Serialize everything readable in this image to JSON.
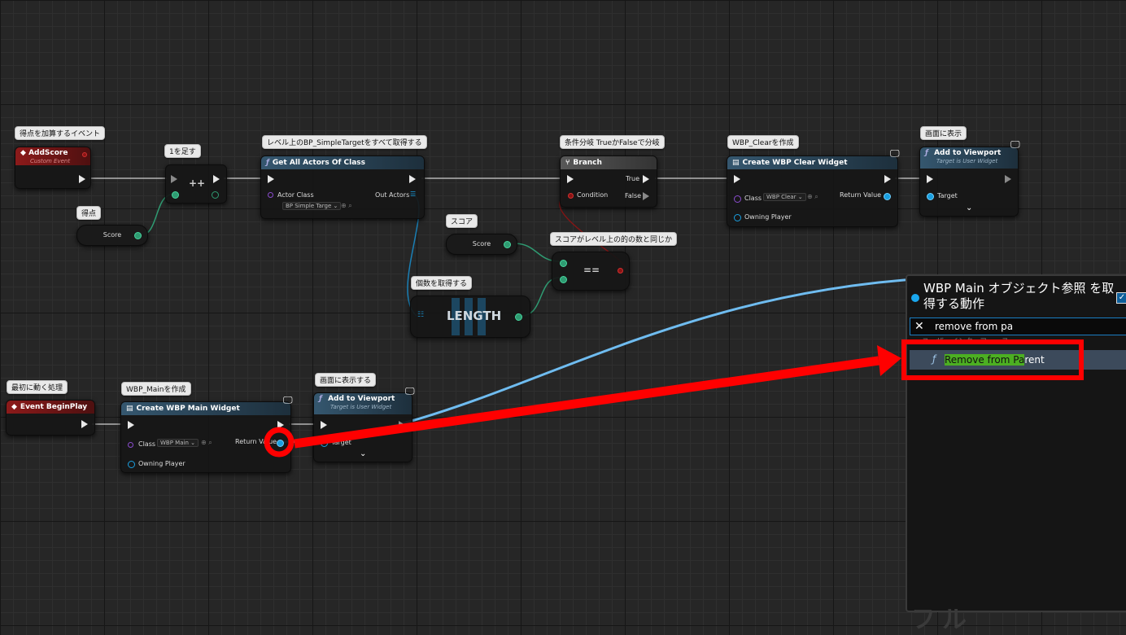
{
  "comments": {
    "add_score_event": "得点を加算するイベント",
    "add_one": "1を足す",
    "get_all_actors": "レベル上のBP_SimpleTargetをすべて取得する",
    "branch_comment": "条件分岐 TrueかFalseで分岐",
    "create_clear": "WBP_Clearを作成",
    "show_clear": "画面に表示",
    "score_var": "得点",
    "score_var2": "スコア",
    "equal_comment": "スコアがレベル上の的の数と同じか",
    "length_comment": "個数を取得する",
    "begin_comment": "最初に動く処理",
    "create_main": "WBP_Mainを作成",
    "show_main": "画面に表示する"
  },
  "nodes": {
    "add_score": {
      "title": "AddScore",
      "subtitle": "Custom Event"
    },
    "increment": {
      "title": "++"
    },
    "get_all_actors": {
      "title": "Get All Actors Of Class",
      "actor_class_label": "Actor Class",
      "actor_class_value": "BP Simple Targe",
      "out_actors_label": "Out Actors"
    },
    "branch": {
      "title": "Branch",
      "true_label": "True",
      "false_label": "False",
      "condition_label": "Condition"
    },
    "create_clear": {
      "title": "Create WBP Clear Widget",
      "class_label": "Class",
      "class_value": "WBP Clear",
      "return_label": "Return Value",
      "owning_label": "Owning Player"
    },
    "add_viewport_top": {
      "title": "Add to Viewport",
      "subtitle": "Target is User Widget",
      "target_label": "Target"
    },
    "score_top": {
      "label": "Score"
    },
    "score_mid": {
      "label": "Score"
    },
    "equal": {
      "title": "=="
    },
    "length": {
      "title": "LENGTH"
    },
    "begin_play": {
      "title": "Event BeginPlay"
    },
    "create_main": {
      "title": "Create WBP Main Widget",
      "class_label": "Class",
      "class_value": "WBP Main",
      "return_label": "Return Value",
      "owning_label": "Owning Player"
    },
    "add_viewport_bottom": {
      "title": "Add to Viewport",
      "subtitle": "Target is User Widget",
      "target_label": "Target"
    }
  },
  "context_menu": {
    "title": "WBP Main オブジェクト参照 を取得する動作",
    "search_value": "remove from pa",
    "category_hint": "ユーザーインターフェース",
    "item_highlight": "Remove from Pa",
    "item_rest": "rent"
  },
  "icons": {
    "event": "diamond-icon",
    "function": "function-f-icon",
    "branch": "branch-icon",
    "widget": "widget-icon",
    "monitor": "monitor-icon",
    "close": "close-x-icon",
    "checkbox": "checkbox-icon",
    "chevron": "chevron-down-icon"
  },
  "colors": {
    "exec": "#e8e8e8",
    "object_ref": "#1a9fe0",
    "int_pin": "#2f9b72",
    "annotation": "#ff0000",
    "search_highlight": "#4caf22"
  },
  "watermark": "フル"
}
